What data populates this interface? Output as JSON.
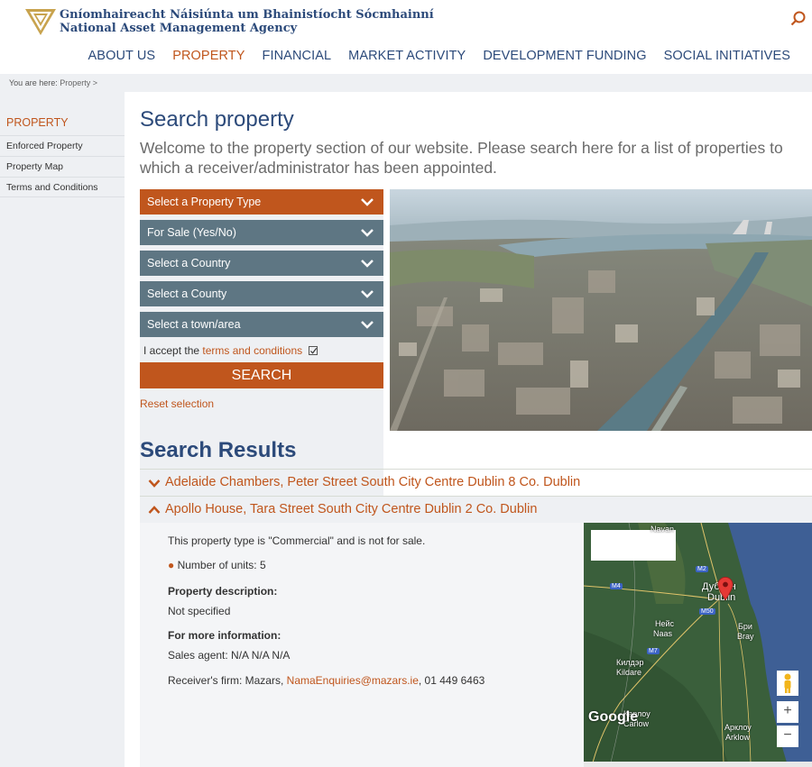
{
  "header": {
    "org_name_irish": "Gníomhaireacht Náisiúnta um Bhainistíocht Sócmhainní",
    "org_name_english": "National Asset Management Agency",
    "nav": [
      "ABOUT US",
      "PROPERTY",
      "FINANCIAL",
      "MARKET ACTIVITY",
      "DEVELOPMENT FUNDING",
      "SOCIAL INITIATIVES"
    ],
    "active_nav": "PROPERTY"
  },
  "breadcrumb": {
    "prefix": "You are here:",
    "items": [
      "Property >"
    ]
  },
  "sidebar": {
    "heading": "PROPERTY",
    "items": [
      "Enforced Property",
      "Property Map",
      "Terms and Conditions"
    ]
  },
  "main": {
    "title": "Search property",
    "intro": "Welcome to the property section of our website. Please search here for a list of properties to which a receiver/administrator has been appointed.",
    "filters": {
      "dropdowns": [
        "Select a Property Type",
        "For Sale (Yes/No)",
        "Select a Country",
        "Select a County",
        "Select a town/area"
      ],
      "terms_prefix": "I accept the",
      "terms_link": "terms and conditions",
      "search_label": "SEARCH",
      "reset_label": "Reset selection"
    },
    "results_title": "Search Results",
    "results": [
      "Adelaide Chambers, Peter Street South City Centre Dublin 8 Co. Dublin",
      "Apollo House, Tara Street South City Centre Dublin 2 Co. Dublin"
    ],
    "detail": {
      "type_line": "This property type is \"Commercial\" and is not for sale.",
      "units_line": "Number of units: 5",
      "description_heading": "Property description:",
      "description_value": "Not specified",
      "info_heading": "For more information:",
      "sales_agent": "Sales agent: N/A N/A N/A",
      "receiver_prefix": "Receiver's firm: Mazars,",
      "receiver_email": "NamaEnquiries@mazars.ie",
      "receiver_phone": ", 01 449 6463"
    },
    "map": {
      "labels": [
        "Navan",
        "Дублин",
        "Dublin",
        "Нейс",
        "Naas",
        "Бри",
        "Bray",
        "Килдэр",
        "Kildare",
        "Арклоу",
        "Arklow",
        "Карлоу",
        "Carlow"
      ],
      "roads": [
        "M2",
        "M4",
        "M50",
        "M7"
      ],
      "logo": "Google",
      "zoom_in": "+",
      "zoom_out": "−"
    }
  },
  "colors": {
    "brand_blue": "#2c4a7a",
    "accent_orange": "#c0561d",
    "slate": "#5e7683"
  }
}
